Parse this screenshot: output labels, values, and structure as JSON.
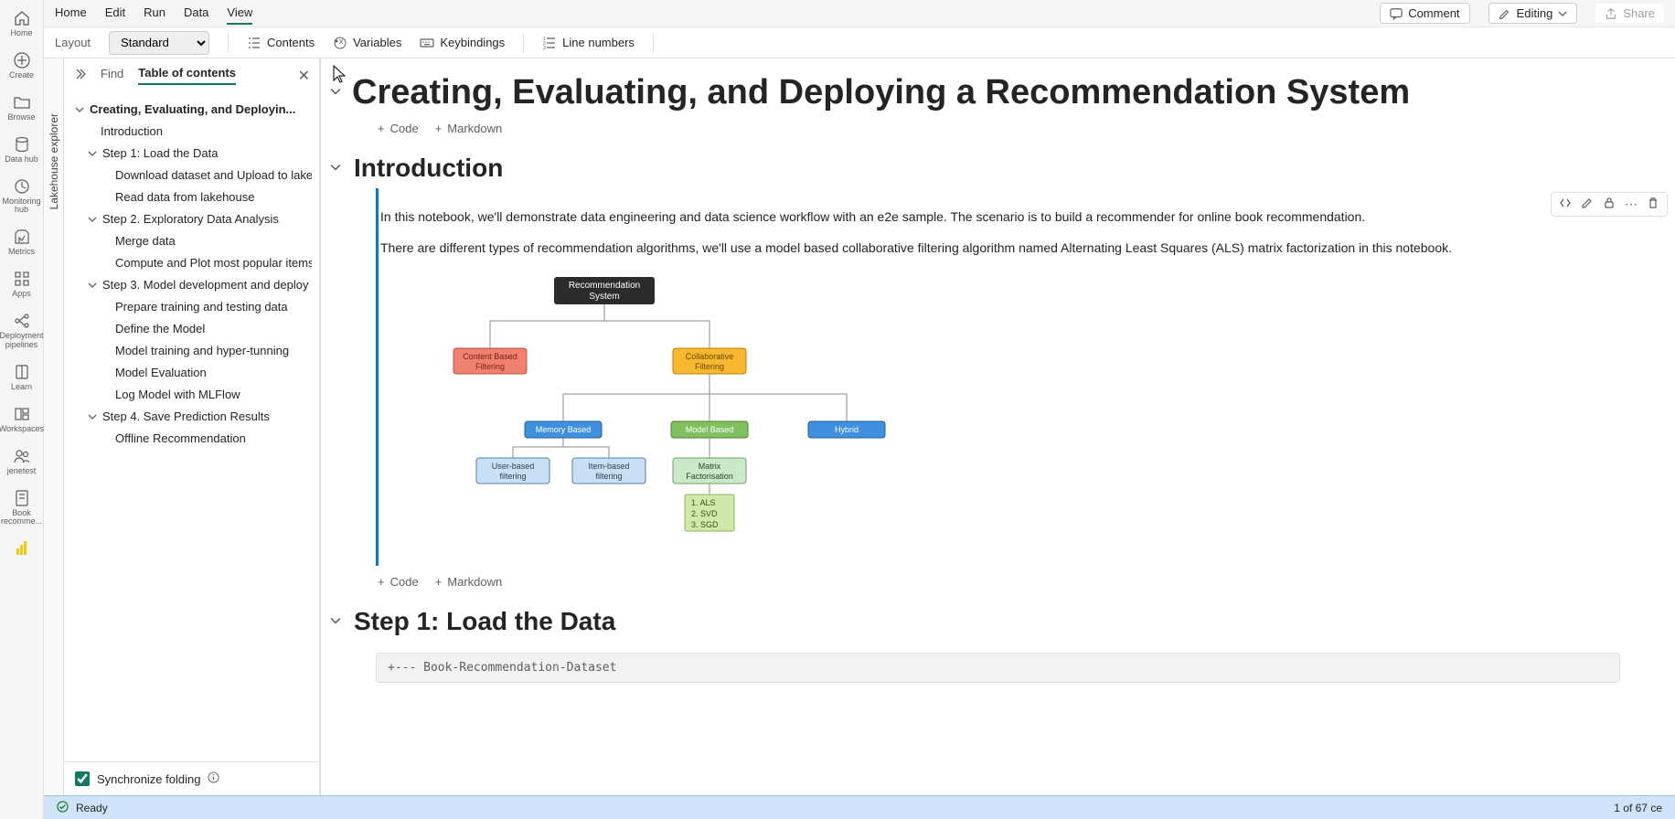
{
  "rail": [
    {
      "label": "Home",
      "icon": "home"
    },
    {
      "label": "Create",
      "icon": "plus"
    },
    {
      "label": "Browse",
      "icon": "folder"
    },
    {
      "label": "Data hub",
      "icon": "datahub"
    },
    {
      "label": "Monitoring hub",
      "icon": "monitor"
    },
    {
      "label": "Metrics",
      "icon": "metrics"
    },
    {
      "label": "Apps",
      "icon": "apps"
    },
    {
      "label": "Deployment pipelines",
      "icon": "pipeline"
    },
    {
      "label": "Learn",
      "icon": "learn"
    },
    {
      "label": "Workspaces",
      "icon": "workspaces"
    },
    {
      "label": "jenetest",
      "icon": "people"
    },
    {
      "label": "Book recomme...",
      "icon": "notebook"
    }
  ],
  "menu": {
    "items": [
      "Home",
      "Edit",
      "Run",
      "Data",
      "View"
    ],
    "active": 4,
    "comment": "Comment",
    "editing": "Editing",
    "share": "Share"
  },
  "toolbar": {
    "layout_label": "Layout",
    "layout_value": "Standard",
    "contents": "Contents",
    "variables": "Variables",
    "keybindings": "Keybindings",
    "linenumbers": "Line numbers"
  },
  "lakehouse_strip": "Lakehouse explorer",
  "sidebar": {
    "find": "Find",
    "toc": "Table of contents",
    "root": "Creating, Evaluating, and Deployin...",
    "items": [
      {
        "level": 2,
        "label": "Introduction"
      },
      {
        "level": 2,
        "label": "Step 1: Load the Data",
        "chev": true
      },
      {
        "level": 3,
        "label": "Download dataset and Upload to lakeh..."
      },
      {
        "level": 3,
        "label": "Read data from lakehouse"
      },
      {
        "level": 2,
        "label": "Step 2. Exploratory Data Analysis",
        "chev": true
      },
      {
        "level": 3,
        "label": "Merge data"
      },
      {
        "level": 3,
        "label": "Compute and Plot most popular items"
      },
      {
        "level": 2,
        "label": "Step 3. Model development and deploy",
        "chev": true
      },
      {
        "level": 3,
        "label": "Prepare training and testing data"
      },
      {
        "level": 3,
        "label": "Define the Model"
      },
      {
        "level": 3,
        "label": "Model training and hyper-tunning"
      },
      {
        "level": 3,
        "label": "Model Evaluation"
      },
      {
        "level": 3,
        "label": "Log Model with MLFlow"
      },
      {
        "level": 2,
        "label": "Step 4. Save Prediction Results",
        "chev": true
      },
      {
        "level": 3,
        "label": "Offline Recommendation"
      }
    ],
    "sync": "Synchronize folding"
  },
  "content": {
    "title": "Creating, Evaluating, and Deploying a Recommendation System",
    "add_code": "Code",
    "add_md": "Markdown",
    "intro_heading": "Introduction",
    "intro_p1": "In this notebook, we'll demonstrate data engineering and data science workflow with an e2e sample. The scenario is to build a recommender for online book recommendation.",
    "intro_p2": "There are different types of recommendation algorithms, we'll use a model based collaborative filtering algorithm named Alternating Least Squares (ALS) matrix factorization in this notebook.",
    "diagram": {
      "root": "Recommendation\nSystem",
      "l1": [
        "Content Based\nFiltering",
        "Collaborative\nFiltering"
      ],
      "l2": [
        "Memory Based",
        "Model Based",
        "Hybrid"
      ],
      "l3": [
        "User-based\nfiltering",
        "Item-based\nfiltering",
        "Matrix\nFactorisation"
      ],
      "algs": "1. ALS\n2. SVD\n3. SGD"
    },
    "step1_heading": "Step 1: Load the Data",
    "code_preview": "+--- Book-Recommendation-Dataset"
  },
  "status": {
    "ready": "Ready",
    "cells": "1 of 67 ce"
  }
}
